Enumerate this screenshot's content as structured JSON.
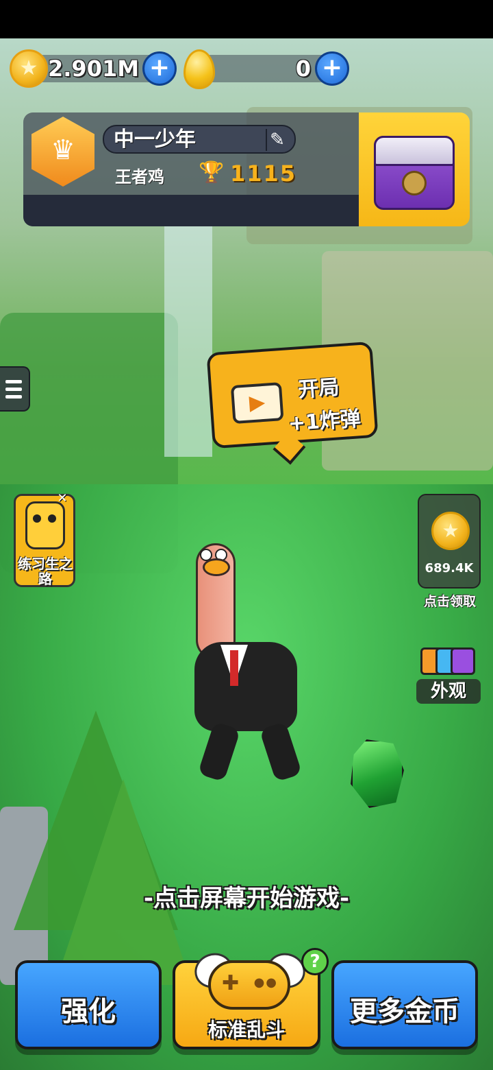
{
  "currency": {
    "coins": "2.901M",
    "eggs": "0",
    "coin_icon": "star-coin-icon",
    "egg_icon": "golden-egg-icon",
    "add_icon": "plus-icon"
  },
  "profile": {
    "name": "中一少年",
    "title": "王者鸡",
    "trophies": "1115",
    "rank_icon": "crown-badge-icon",
    "edit_icon": "pencil-icon",
    "chest_icon": "treasure-chest-icon"
  },
  "video_bubble": {
    "line1": "开局",
    "line2": "+1炸弹",
    "icon": "video-play-icon"
  },
  "side_left": {
    "menu_icon": "hamburger-menu-icon",
    "trainee_label": "练习生之路"
  },
  "side_right": {
    "collect_value": "689.4K",
    "collect_label": "点击领取",
    "appearance_label": "外观"
  },
  "prompt": "-点击屏幕开始游戏-",
  "bottom": {
    "upgrade_label": "强化",
    "mode_label": "标准乱斗",
    "more_coins_label": "更多金币",
    "help": "?"
  },
  "colors": {
    "accent_yellow": "#f7b21c",
    "button_blue": "#1b6fe0",
    "help_green": "#5fd14a"
  }
}
